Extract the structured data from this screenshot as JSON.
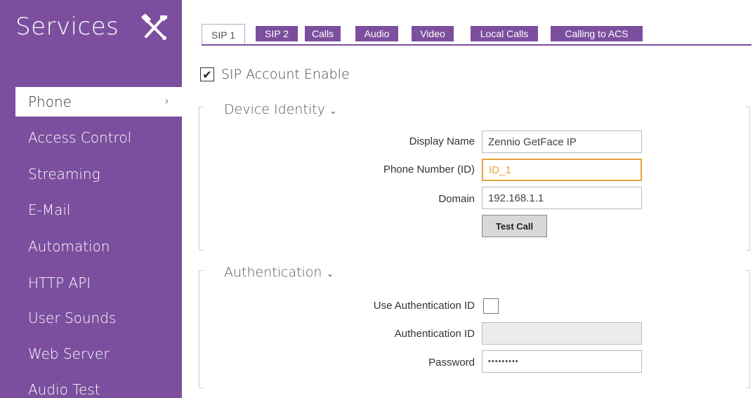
{
  "sidebar": {
    "title": "Services",
    "tools_icon": "tools-icon",
    "items": [
      {
        "label": "Phone",
        "active": true
      },
      {
        "label": "Access Control"
      },
      {
        "label": "Streaming"
      },
      {
        "label": "E-Mail"
      },
      {
        "label": "Automation"
      },
      {
        "label": "HTTP API"
      },
      {
        "label": "User Sounds"
      },
      {
        "label": "Web Server"
      },
      {
        "label": "Audio Test"
      }
    ],
    "active_chevron": "›"
  },
  "tabs": [
    {
      "label": "SIP 1",
      "active": true
    },
    {
      "label": "SIP 2"
    },
    {
      "label": "Calls"
    },
    {
      "label": "Audio"
    },
    {
      "label": "Video"
    },
    {
      "label": "Local Calls"
    },
    {
      "label": "Calling to ACS"
    }
  ],
  "sip_enable": {
    "label": "SIP Account Enable",
    "checked": true,
    "check_glyph": "✔"
  },
  "device_identity": {
    "title": "Device Identity",
    "caret": "⌄",
    "display_name": {
      "label": "Display Name",
      "value": "Zennio GetFace IP"
    },
    "phone_number": {
      "label": "Phone Number (ID)",
      "value": "ID_1"
    },
    "domain": {
      "label": "Domain",
      "value": "192.168.1.1"
    },
    "test_call": "Test Call"
  },
  "authentication": {
    "title": "Authentication",
    "caret": "⌄",
    "use_auth_id": {
      "label": "Use Authentication ID",
      "checked": false
    },
    "auth_id": {
      "label": "Authentication ID",
      "value": ""
    },
    "password": {
      "label": "Password",
      "value": "•••••••••"
    }
  },
  "colors": {
    "accent": "#7c4f9e",
    "focus": "#e9a13b"
  }
}
